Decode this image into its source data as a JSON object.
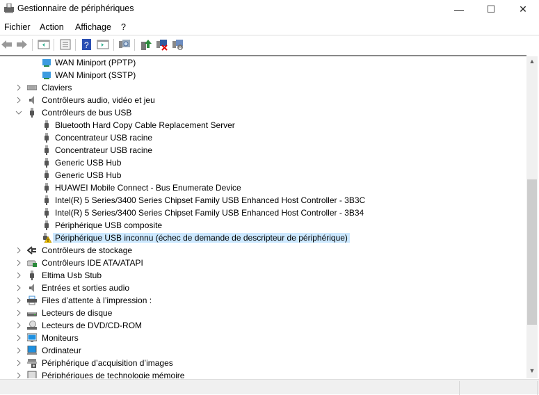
{
  "window": {
    "title": "Gestionnaire de périphériques",
    "minimize": "—",
    "maximize": "☐",
    "close": "✕"
  },
  "menu": [
    "Fichier",
    "Action",
    "Affichage",
    "?"
  ],
  "toolbar": [
    "back-icon",
    "forward-icon",
    "show-hide-console-tree-icon",
    "properties-icon",
    "help-icon",
    "show-action-pane-icon",
    "scan-hardware-icon",
    "update-driver-icon",
    "uninstall-device-icon",
    "disable-device-icon"
  ],
  "tree": [
    {
      "label": "WAN Miniport (PPTP)",
      "level": 1,
      "icon": "network-adapter-icon"
    },
    {
      "label": "WAN Miniport (SSTP)",
      "level": 1,
      "icon": "network-adapter-icon"
    },
    {
      "label": "Claviers",
      "level": 0,
      "expander": ">",
      "icon": "keyboard-icon"
    },
    {
      "label": "Contrôleurs audio, vidéo et jeu",
      "level": 0,
      "expander": ">",
      "icon": "speaker-icon"
    },
    {
      "label": "Contrôleurs de bus USB",
      "level": 0,
      "expander": "v",
      "icon": "usb-icon"
    },
    {
      "label": "Bluetooth Hard Copy Cable Replacement Server",
      "level": 1,
      "icon": "usb-icon"
    },
    {
      "label": "Concentrateur USB racine",
      "level": 1,
      "icon": "usb-icon"
    },
    {
      "label": "Concentrateur USB racine",
      "level": 1,
      "icon": "usb-icon"
    },
    {
      "label": "Generic USB Hub",
      "level": 1,
      "icon": "usb-icon"
    },
    {
      "label": "Generic USB Hub",
      "level": 1,
      "icon": "usb-icon"
    },
    {
      "label": "HUAWEI Mobile Connect - Bus Enumerate Device",
      "level": 1,
      "icon": "usb-icon"
    },
    {
      "label": "Intel(R) 5 Series/3400 Series Chipset Family USB Enhanced Host Controller - 3B3C",
      "level": 1,
      "icon": "usb-icon"
    },
    {
      "label": "Intel(R) 5 Series/3400 Series Chipset Family USB Enhanced Host Controller - 3B34",
      "level": 1,
      "icon": "usb-icon"
    },
    {
      "label": "Périphérique USB composite",
      "level": 1,
      "icon": "usb-icon"
    },
    {
      "label": "Périphérique USB inconnu (échec de demande de descripteur de périphérique)",
      "level": 1,
      "icon": "usb-warning-icon",
      "selected": true
    },
    {
      "label": "Contrôleurs de stockage",
      "level": 0,
      "expander": ">",
      "icon": "storage-controller-icon"
    },
    {
      "label": "Contrôleurs IDE ATA/ATAPI",
      "level": 0,
      "expander": ">",
      "icon": "ide-controller-icon"
    },
    {
      "label": "Eltima Usb Stub",
      "level": 0,
      "expander": ">",
      "icon": "usb-icon"
    },
    {
      "label": "Entrées et sorties audio",
      "level": 0,
      "expander": ">",
      "icon": "speaker-icon"
    },
    {
      "label": "Files d’attente à l’impression :",
      "level": 0,
      "expander": ">",
      "icon": "printer-icon"
    },
    {
      "label": "Lecteurs de disque",
      "level": 0,
      "expander": ">",
      "icon": "disk-drive-icon"
    },
    {
      "label": "Lecteurs de DVD/CD-ROM",
      "level": 0,
      "expander": ">",
      "icon": "dvd-drive-icon"
    },
    {
      "label": "Moniteurs",
      "level": 0,
      "expander": ">",
      "icon": "monitor-icon"
    },
    {
      "label": "Ordinateur",
      "level": 0,
      "expander": ">",
      "icon": "computer-icon"
    },
    {
      "label": "Périphérique d’acquisition d’images",
      "level": 0,
      "expander": ">",
      "icon": "camera-scanner-icon"
    },
    {
      "label": "Périphériques de technologie mémoire",
      "level": 0,
      "expander": ">",
      "icon": "memory-device-icon"
    }
  ],
  "colors": {
    "selection": "#cce8ff",
    "scroll_thumb": "#cdcdcd"
  }
}
